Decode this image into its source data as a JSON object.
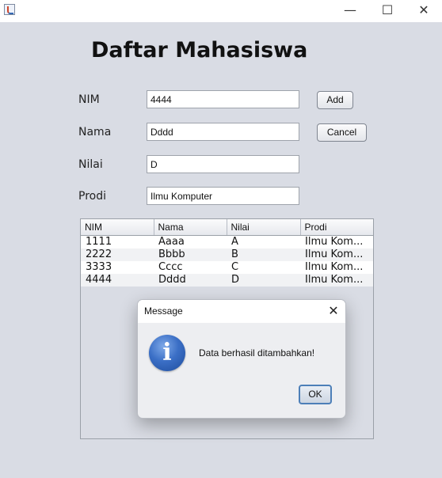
{
  "window": {
    "minimize_glyph": "—",
    "maximize_glyph": "☐",
    "close_glyph": "✕",
    "icon": "java-app-icon"
  },
  "heading": "Daftar Mahasiswa",
  "form": {
    "nim_label": "NIM",
    "nim_value": "4444",
    "nama_label": "Nama",
    "nama_value": "Dddd",
    "nilai_label": "Nilai",
    "nilai_value": "D",
    "prodi_label": "Prodi",
    "prodi_value": "Ilmu Komputer",
    "add_label": "Add",
    "cancel_label": "Cancel"
  },
  "table": {
    "columns": [
      "NIM",
      "Nama",
      "Nilai",
      "Prodi"
    ],
    "rows": [
      [
        "1111",
        "Aaaa",
        "A",
        "Ilmu Kom..."
      ],
      [
        "2222",
        "Bbbb",
        "B",
        "Ilmu Kom..."
      ],
      [
        "3333",
        "Cccc",
        "C",
        "Ilmu Kom..."
      ],
      [
        "4444",
        "Dddd",
        "D",
        "Ilmu Kom..."
      ]
    ]
  },
  "dialog": {
    "title": "Message",
    "close_glyph": "✕",
    "icon": "info-icon",
    "icon_glyph": "i",
    "message": "Data berhasil ditambahkan!",
    "ok_label": "OK"
  }
}
